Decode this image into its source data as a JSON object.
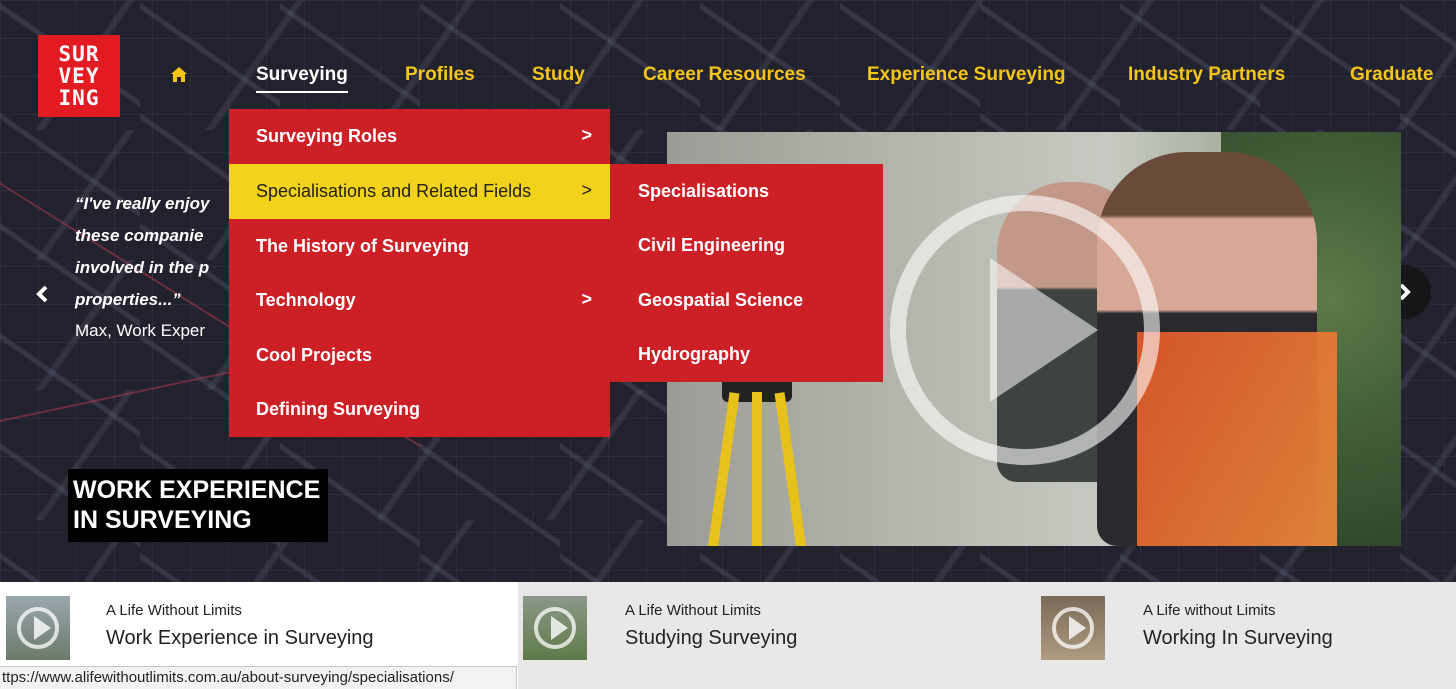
{
  "logo": {
    "lines": [
      "SUR",
      "VEY",
      "ING"
    ]
  },
  "nav": {
    "home_icon": "home-icon",
    "items": [
      {
        "label": "Surveying",
        "active": true
      },
      {
        "label": "Profiles"
      },
      {
        "label": "Study"
      },
      {
        "label": "Career Resources"
      },
      {
        "label": "Experience Surveying"
      },
      {
        "label": "Industry Partners"
      },
      {
        "label": "Graduate"
      }
    ]
  },
  "hero": {
    "quote_lines": [
      "“I've really enjoy",
      "these companie",
      "involved in the p",
      "properties...”"
    ],
    "author": "Max, Work Exper",
    "title_line1": "WORK EXPERIENCE",
    "title_line2": "IN SURVEYING",
    "prev_icon": "chevron-left-icon",
    "next_icon": "chevron-right-icon"
  },
  "menu": {
    "items": [
      {
        "label": "Surveying Roles",
        "has_sub": true,
        "chevron": ">"
      },
      {
        "label": "Specialisations and Related Fields",
        "has_sub": true,
        "chevron": ">",
        "highlighted": true
      },
      {
        "label": "The History of Surveying"
      },
      {
        "label": "Technology",
        "has_sub": true,
        "chevron": ">"
      },
      {
        "label": "Cool Projects"
      },
      {
        "label": "Defining Surveying"
      }
    ],
    "submenu": [
      "Specialisations",
      "Civil Engineering",
      "Geospatial Science",
      "Hydrography"
    ]
  },
  "video_cards": [
    {
      "subtitle": "A Life Without Limits",
      "title": "Work Experience in Surveying"
    },
    {
      "subtitle": "A Life Without Limits",
      "title": "Studying Surveying"
    },
    {
      "subtitle": "A Life without Limits",
      "title": "Working In Surveying"
    }
  ],
  "status_url": "ttps://www.alifewithoutlimits.com.au/about-surveying/specialisations/",
  "colors": {
    "brand_red": "#cc1f26",
    "nav_yellow": "#f5c518",
    "highlight_yellow": "#f3d21c"
  }
}
